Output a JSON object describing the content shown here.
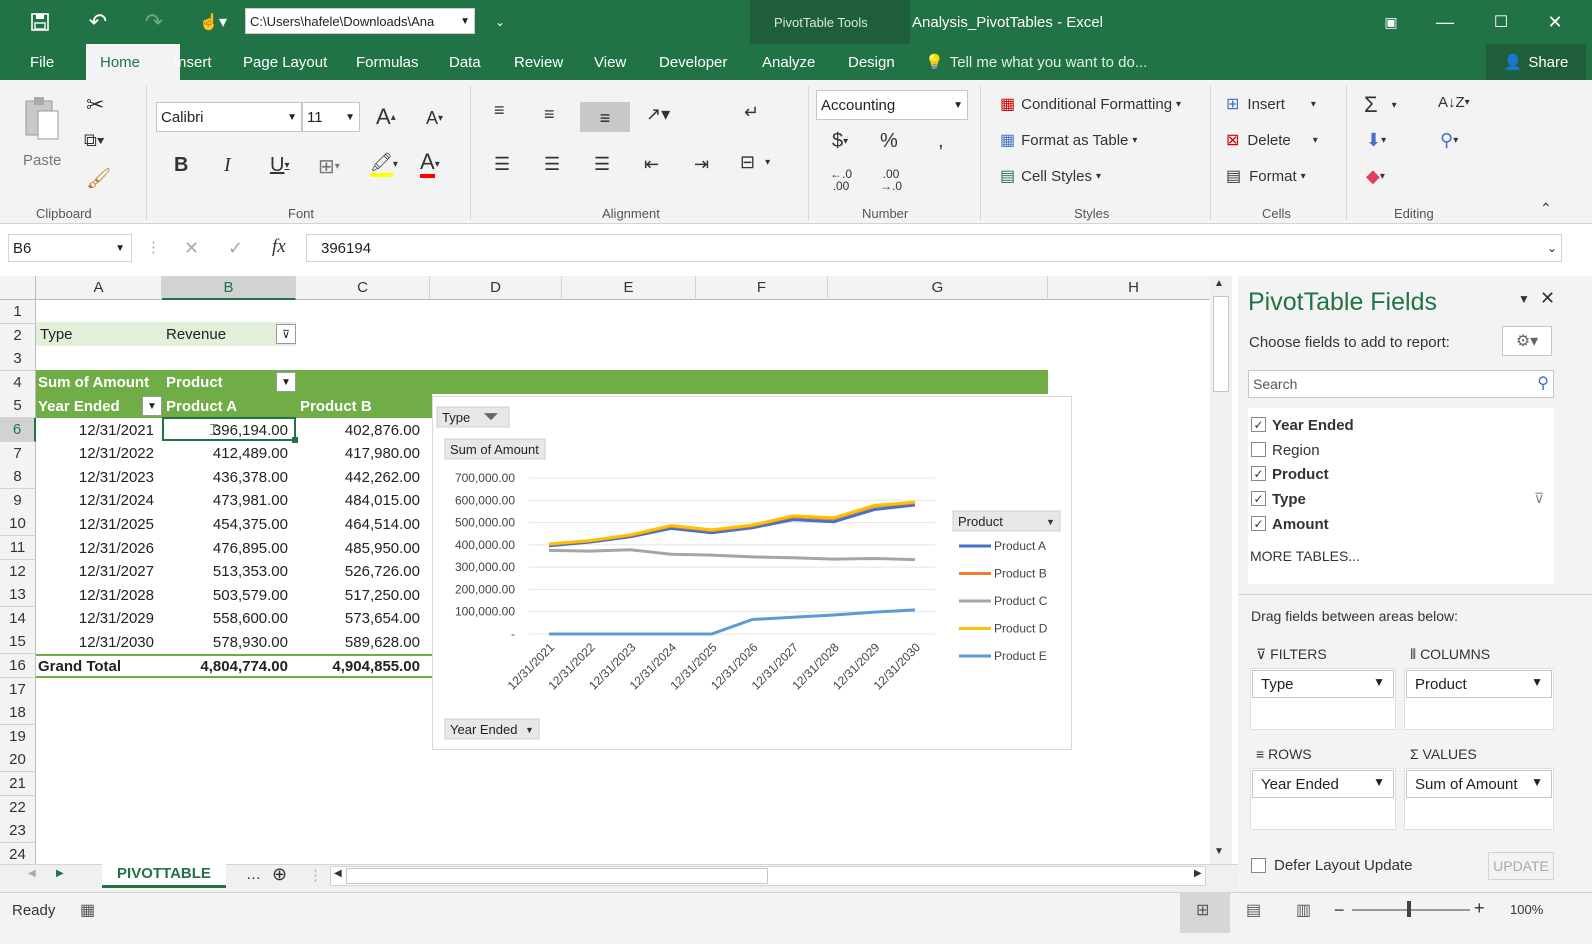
{
  "titlebar": {
    "path": "C:\\Users\\hafele\\Downloads\\Ana",
    "context_tools": "PivotTable Tools",
    "title": "Analysis_PivotTables - Excel"
  },
  "tabs": [
    "File",
    "Home",
    "Insert",
    "Page Layout",
    "Formulas",
    "Data",
    "Review",
    "View",
    "Developer",
    "Analyze",
    "Design"
  ],
  "tell_me": "Tell me what you want to do...",
  "share": "Share",
  "ribbon": {
    "paste": "Paste",
    "font_name": "Calibri",
    "font_size": "11",
    "number_format": "Accounting",
    "conditional_formatting": "Conditional Formatting",
    "format_as_table": "Format as Table",
    "cell_styles": "Cell Styles",
    "insert": "Insert",
    "delete": "Delete",
    "format": "Format",
    "inc_decimal": ".0\n.00",
    "groups": {
      "clipboard": "Clipboard",
      "font": "Font",
      "alignment": "Alignment",
      "number": "Number",
      "styles": "Styles",
      "cells": "Cells",
      "editing": "Editing"
    }
  },
  "formula_bar": {
    "name_box": "B6",
    "fx": "fx",
    "value": "396194"
  },
  "columns": [
    "A",
    "B",
    "C",
    "D",
    "E",
    "F",
    "G",
    "H"
  ],
  "rows": [
    "1",
    "2",
    "3",
    "4",
    "5",
    "6",
    "7",
    "8",
    "9",
    "10",
    "11",
    "12",
    "13",
    "14",
    "15",
    "16",
    "17",
    "18",
    "19",
    "20",
    "21",
    "22",
    "23",
    "24"
  ],
  "pivot": {
    "filter_label": "Type",
    "filter_value": "Revenue",
    "sum_label": "Sum of Amount",
    "col_field": "Product",
    "row_field": "Year Ended",
    "headers": [
      "Product A",
      "Product B"
    ],
    "data": [
      [
        "12/31/2021",
        "396,194.00",
        "402,876.00"
      ],
      [
        "12/31/2022",
        "412,489.00",
        "417,980.00"
      ],
      [
        "12/31/2023",
        "436,378.00",
        "442,262.00"
      ],
      [
        "12/31/2024",
        "473,981.00",
        "484,015.00"
      ],
      [
        "12/31/2025",
        "454,375.00",
        "464,514.00"
      ],
      [
        "12/31/2026",
        "476,895.00",
        "485,950.00"
      ],
      [
        "12/31/2027",
        "513,353.00",
        "526,726.00"
      ],
      [
        "12/31/2028",
        "503,579.00",
        "517,250.00"
      ],
      [
        "12/31/2029",
        "558,600.00",
        "573,654.00"
      ],
      [
        "12/31/2030",
        "578,930.00",
        "589,628.00"
      ]
    ],
    "grand_total_label": "Grand Total",
    "grand_totals": [
      "4,804,774.00",
      "4,904,855.00"
    ]
  },
  "chart_buttons": {
    "type": "Type",
    "value": "Sum of Amount",
    "axis": "Year Ended",
    "legend": "Product"
  },
  "chart_data": {
    "type": "line",
    "x": [
      "12/31/2021",
      "12/31/2022",
      "12/31/2023",
      "12/31/2024",
      "12/31/2025",
      "12/31/2026",
      "12/31/2027",
      "12/31/2028",
      "12/31/2029",
      "12/31/2030"
    ],
    "y_ticks": [
      "700,000.00",
      "600,000.00",
      "500,000.00",
      "400,000.00",
      "300,000.00",
      "200,000.00",
      "100,000.00",
      "-"
    ],
    "ylim": [
      0,
      700000
    ],
    "grid": true,
    "legend_position": "right",
    "series": [
      {
        "name": "Product A",
        "color": "#4472c4",
        "values": [
          396194,
          412489,
          436378,
          473981,
          454375,
          476895,
          513353,
          503579,
          558600,
          578930
        ]
      },
      {
        "name": "Product B",
        "color": "#ed7d31",
        "values": [
          402876,
          417980,
          442262,
          484015,
          464514,
          485950,
          526726,
          517250,
          573654,
          589628
        ]
      },
      {
        "name": "Product C",
        "color": "#a5a5a5",
        "values": [
          375000,
          372000,
          378000,
          358000,
          354000,
          346000,
          342000,
          336000,
          339000,
          334000
        ]
      },
      {
        "name": "Product D",
        "color": "#ffc000",
        "values": [
          404000,
          419000,
          445000,
          487000,
          467000,
          489000,
          530000,
          521000,
          577000,
          592000
        ]
      },
      {
        "name": "Product E",
        "color": "#5b9bd5",
        "values": [
          0,
          0,
          0,
          0,
          0,
          65000,
          75000,
          85000,
          98000,
          108000
        ]
      }
    ]
  },
  "panel": {
    "title": "PivotTable Fields",
    "subtitle": "Choose fields to add to report:",
    "search_placeholder": "Search",
    "fields": [
      {
        "label": "Year Ended",
        "checked": "✓"
      },
      {
        "label": "Region",
        "checked": ""
      },
      {
        "label": "Product",
        "checked": "✓"
      },
      {
        "label": "Type",
        "checked": "✓"
      },
      {
        "label": "Amount",
        "checked": "✓"
      }
    ],
    "more_tables": "MORE TABLES...",
    "drag_label": "Drag fields between areas below:",
    "filters": "FILTERS",
    "columns": "COLUMNS",
    "rows": "ROWS",
    "values": "VALUES",
    "filters_item": "Type",
    "columns_item": "Product",
    "rows_item": "Year Ended",
    "values_item": "Sum of Amount",
    "defer": "Defer Layout Update",
    "update": "UPDATE"
  },
  "sheet_tab": "PIVOTTABLE",
  "status": {
    "ready": "Ready",
    "zoom": "100%"
  }
}
